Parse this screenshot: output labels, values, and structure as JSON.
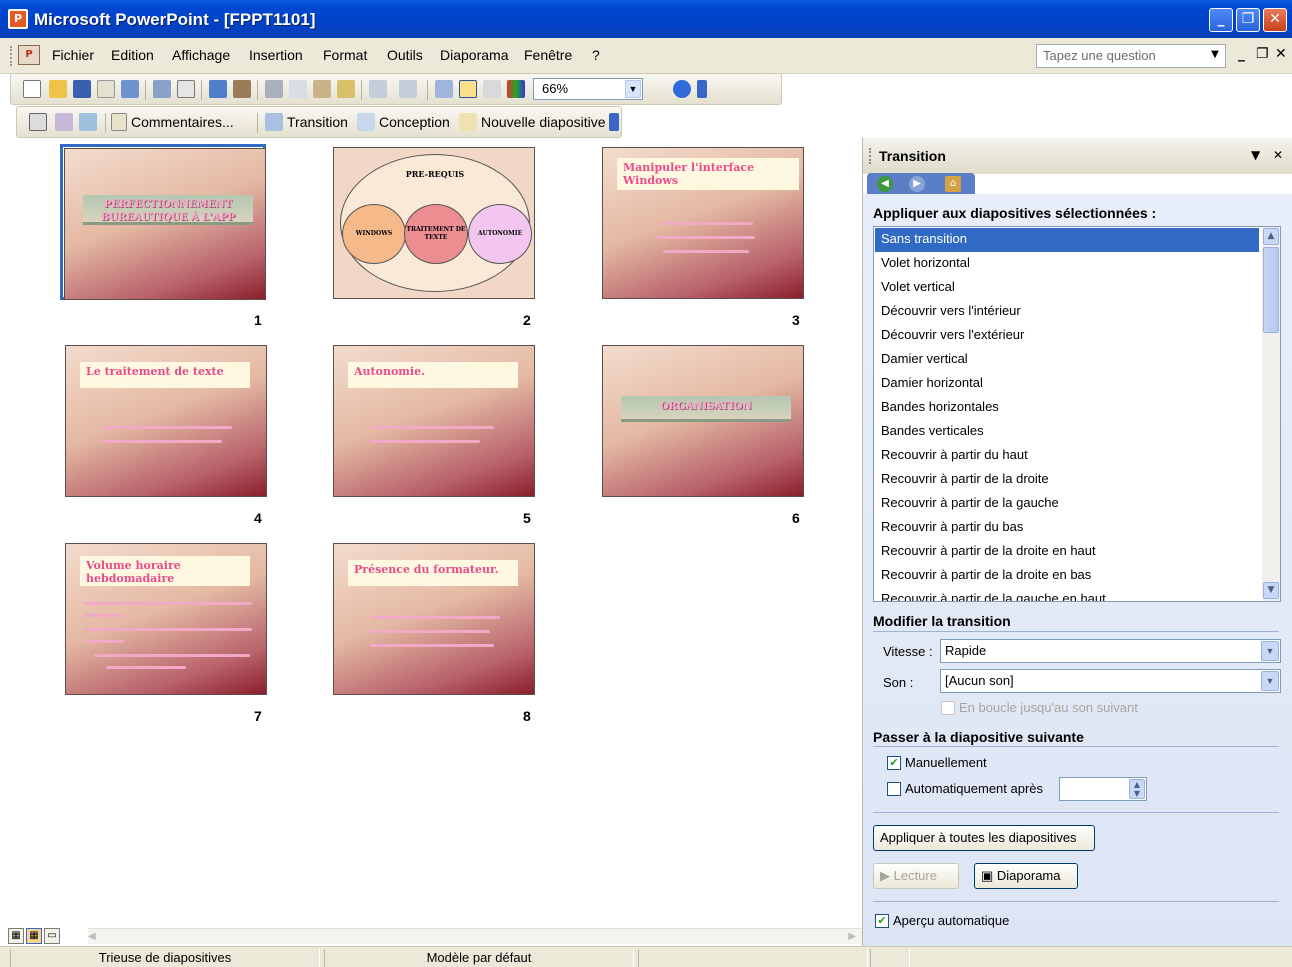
{
  "window": {
    "title": "Microsoft PowerPoint - [FPPT1101]"
  },
  "menu": {
    "items": [
      "Fichier",
      "Edition",
      "Affichage",
      "Insertion",
      "Format",
      "Outils",
      "Diaporama",
      "Fenêtre",
      "?"
    ],
    "ask_placeholder": "Tapez une question"
  },
  "toolbar": {
    "zoom": "66%"
  },
  "toolbar2": {
    "comments": "Commentaires...",
    "transition": "Transition",
    "design": "Conception",
    "new_slide": "Nouvelle diapositive"
  },
  "slides": [
    {
      "num": "1",
      "title": "PERFECTIONNEMENT BUREAUTIQUE À L'APP"
    },
    {
      "num": "2",
      "title": "PRE-REQUIS",
      "circles": [
        "WINDOWS",
        "TRAITEMENT DE TEXTE",
        "AUTONOMIE"
      ]
    },
    {
      "num": "3",
      "title": "Manipuler l'interface Windows"
    },
    {
      "num": "4",
      "title": "Le traitement de texte"
    },
    {
      "num": "5",
      "title": "Autonomie."
    },
    {
      "num": "6",
      "title": "ORGANISATION"
    },
    {
      "num": "7",
      "title": "Volume horaire hebdomadaire"
    },
    {
      "num": "8",
      "title": "Présence du formateur."
    }
  ],
  "status": {
    "view": "Trieuse de diapositives",
    "template": "Modèle par défaut"
  },
  "pane": {
    "title": "Transition",
    "apply_heading": "Appliquer aux diapositives sélectionnées :",
    "transitions": [
      "Sans transition",
      "Volet horizontal",
      "Volet vertical",
      "Découvrir vers l'intérieur",
      "Découvrir vers l'extérieur",
      "Damier vertical",
      "Damier horizontal",
      "Bandes horizontales",
      "Bandes verticales",
      "Recouvrir à partir du haut",
      "Recouvrir à partir de la droite",
      "Recouvrir à partir de la gauche",
      "Recouvrir à partir du bas",
      "Recouvrir à partir de la droite en haut",
      "Recouvrir à partir de la droite en bas",
      "Recouvrir à partir de la gauche en haut"
    ],
    "modify_heading": "Modifier la transition",
    "speed_label": "Vitesse :",
    "speed_value": "Rapide",
    "sound_label": "Son :",
    "sound_value": "[Aucun son]",
    "loop_label": "En boucle jusqu'au son suivant",
    "advance_heading": "Passer à la diapositive suivante",
    "manual_label": "Manuellement",
    "auto_label": "Automatiquement après",
    "apply_all": "Appliquer à toutes les diapositives",
    "play": "Lecture",
    "slideshow": "Diaporama",
    "preview_label": "Aperçu automatique"
  }
}
